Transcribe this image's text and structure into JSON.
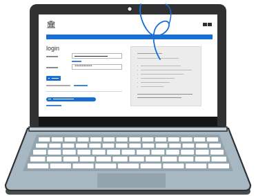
{
  "login_page": {
    "heading": "login",
    "password_mask": "**********"
  },
  "colors": {
    "accent": "#1a6fd4",
    "bezel": "#2f3133",
    "laptop_body": "#a8b8c2",
    "keys": "#ffffff",
    "cable": "#1a6fd4"
  },
  "icons": {
    "logo": "building-icon",
    "menu": "grid-menu-icon",
    "camera": "webcam-icon"
  }
}
